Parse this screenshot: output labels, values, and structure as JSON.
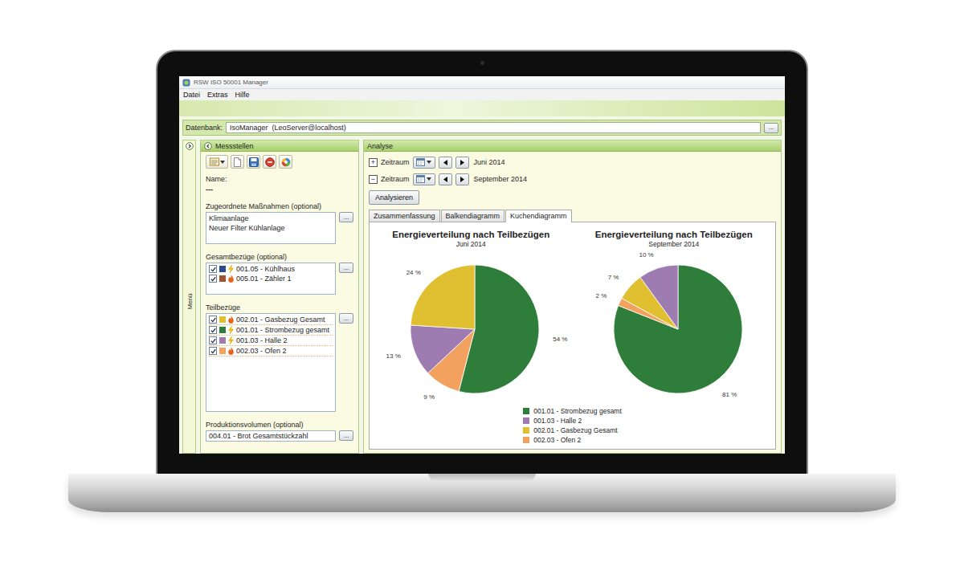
{
  "window": {
    "title": "RSW ISO 50001 Manager"
  },
  "menu": [
    "Datei",
    "Extras",
    "Hilfe"
  ],
  "database": {
    "label": "Datenbank:",
    "value": "IsoManager  (LeoServer@localhost)",
    "button": "..."
  },
  "side_menu": {
    "label": "Menü"
  },
  "messstellen": {
    "title": "Messstellen",
    "name_label": "Name:",
    "name_value": "---",
    "measures": {
      "label": "Zugeordnete Maßnahmen (optional)",
      "items": [
        "Klimaanlage",
        "Neuer Filter Kühlanlage"
      ],
      "button": "..."
    },
    "total": {
      "label": "Gesamtbezüge (optional)",
      "button": "...",
      "items": [
        {
          "name": "001.05 - Kühlhaus",
          "checked": true,
          "color": "#2d4b8e",
          "kind": "electric"
        },
        {
          "name": "005.01 - Zähler 1",
          "checked": true,
          "color": "#a0522d",
          "kind": "gas"
        }
      ]
    },
    "partial": {
      "label": "Teilbezüge",
      "button": "...",
      "items": [
        {
          "name": "002.01 - Gasbezug Gesamt",
          "checked": true,
          "color": "#e0c030",
          "kind": "gas"
        },
        {
          "name": "001.01 - Strombezug gesamt",
          "checked": true,
          "color": "#2e7d3a",
          "kind": "electric"
        },
        {
          "name": "001.03 - Halle 2",
          "checked": true,
          "color": "#9e7bb0",
          "kind": "electric"
        },
        {
          "name": "002.03 - Ofen 2",
          "checked": true,
          "color": "#f2a25e",
          "kind": "gas"
        }
      ]
    },
    "production": {
      "label": "Produktionsvolumen (optional)",
      "value": "004.01 - Brot Gesamtstückzahl",
      "button": "..."
    }
  },
  "analyse": {
    "title": "Analyse",
    "periods": [
      {
        "toggle": "+",
        "label": "Zeitraum",
        "value": "Juni 2014"
      },
      {
        "toggle": "−",
        "label": "Zeitraum",
        "value": "September 2014"
      }
    ],
    "button": "Analysieren",
    "tabs": [
      {
        "label": "Zusammenfassung",
        "selected": false
      },
      {
        "label": "Balkendiagramm",
        "selected": false
      },
      {
        "label": "Kuchendiagramm",
        "selected": true
      }
    ],
    "chart": {
      "panels": [
        {
          "title": "Energieverteilung nach Teilbezügen",
          "period": "Juni 2014"
        },
        {
          "title": "Energieverteilung nach Teilbezügen",
          "period": "September 2014"
        }
      ],
      "series": [
        {
          "name": "001.01 - Strombezug gesamt",
          "color": "#2e7d3a",
          "values": [
            54,
            81
          ],
          "labels": [
            "54 %",
            "81 %"
          ]
        },
        {
          "name": "001.03 - Halle 2",
          "color": "#9e7bb0",
          "values": [
            13,
            10
          ],
          "labels": [
            "13 %",
            "10 %"
          ]
        },
        {
          "name": "002.01 - Gasbezug Gesamt",
          "color": "#e0c030",
          "values": [
            24,
            7
          ],
          "labels": [
            "24 %",
            "7 %"
          ]
        },
        {
          "name": "002.03 - Ofen 2",
          "color": "#f2a25e",
          "values": [
            9,
            2
          ],
          "labels": [
            "9 %",
            "2 %"
          ]
        }
      ]
    }
  }
}
